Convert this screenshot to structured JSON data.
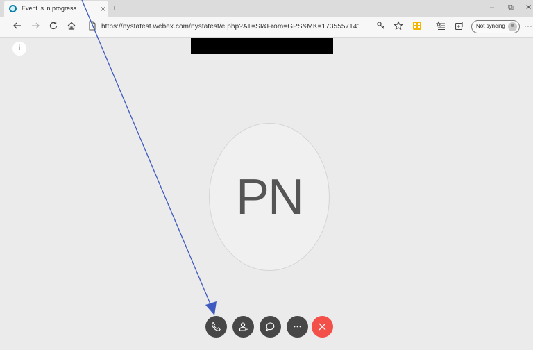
{
  "browser": {
    "tab": {
      "title": "Event is in progress...",
      "close_glyph": "×"
    },
    "new_tab_glyph": "+",
    "window_controls": {
      "minimize": "–",
      "restore": "⧉",
      "close": "✕"
    },
    "toolbar": {
      "back_icon": "back-arrow-icon",
      "forward_icon": "forward-arrow-icon",
      "refresh_icon": "refresh-icon",
      "home_icon": "home-icon",
      "url": "https://nystatest.webex.com/nystatest/e.php?AT=SI&From=GPS&MK=1735557141",
      "sync_label": "Not syncing"
    }
  },
  "meeting": {
    "info_glyph": "i",
    "participant_initials": "PN",
    "controls": [
      {
        "name": "audio-button",
        "icon": "phone-icon"
      },
      {
        "name": "participants-button",
        "icon": "participants-icon"
      },
      {
        "name": "chat-button",
        "icon": "chat-icon"
      },
      {
        "name": "more-options-button",
        "icon": "more-icon",
        "label": "···"
      },
      {
        "name": "leave-button",
        "icon": "close-icon"
      }
    ]
  },
  "colors": {
    "background": "#ebebeb",
    "control_button": "#474747",
    "leave_button": "#f25048",
    "annotation_arrow": "#3f5bbf"
  }
}
